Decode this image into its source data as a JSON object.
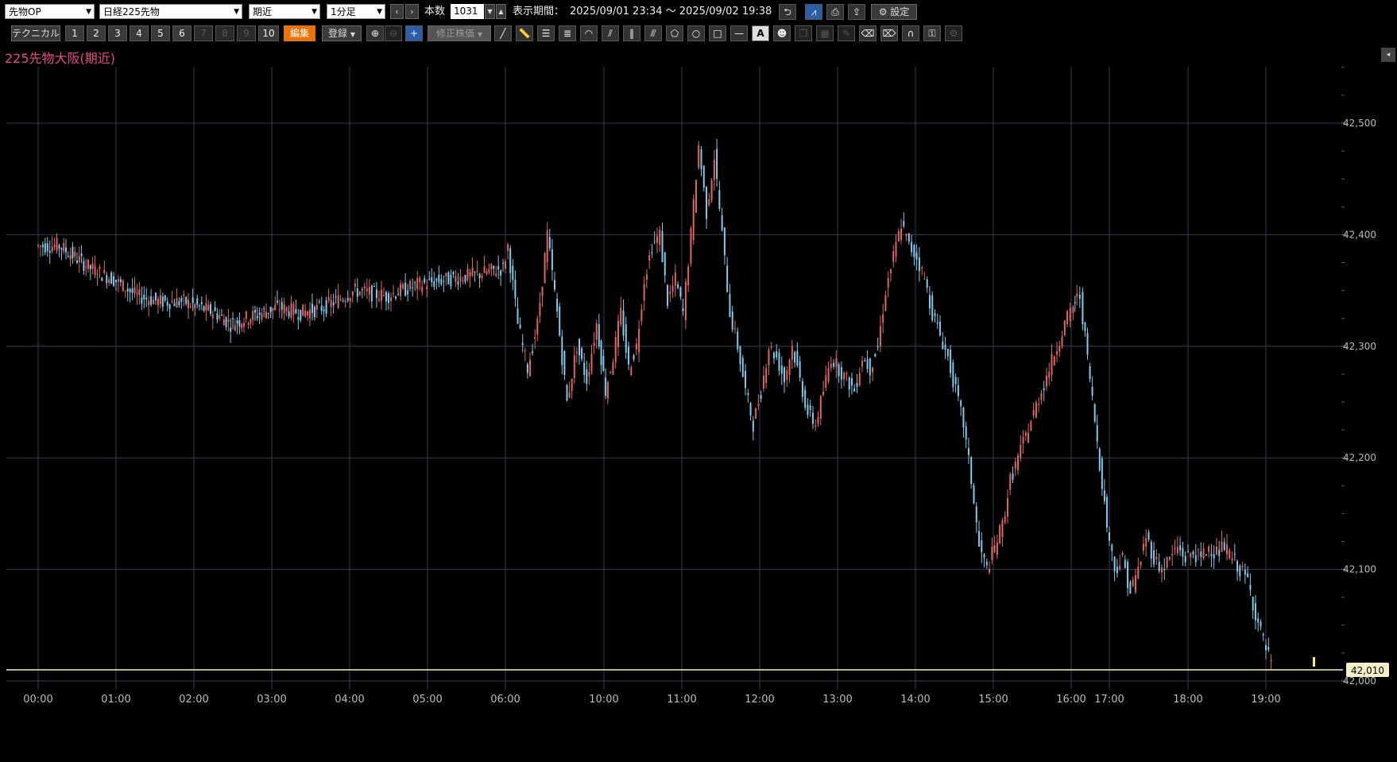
{
  "toolbar": {
    "market_select": "先物OP",
    "product_select": "日経225先物",
    "contract_select": "期近",
    "interval_select": "1分足",
    "count_label": "本数",
    "count_value": "1031",
    "period_label": "表示期間：",
    "period_value": "2025/09/01 23:34 ～ 2025/09/02 19:38",
    "settings_label": "設定",
    "technical_label": "テクニカル",
    "numbers": [
      "1",
      "2",
      "3",
      "4",
      "5",
      "6",
      "7",
      "8",
      "9",
      "10"
    ],
    "edit_label": "編集",
    "register_label": "登録",
    "adjusted_price_label": "修正株価"
  },
  "chart_title": "225先物大阪(期近)",
  "current_price_label": "42,010",
  "colors": {
    "up": "#e06666",
    "down": "#7ecbeb",
    "grid": "#3a3a55",
    "title": "#e8458c",
    "price_line": "#f5f0c8"
  },
  "chart_data": {
    "type": "candlestick",
    "x_ticks": [
      "00:00",
      "01:00",
      "02:00",
      "03:00",
      "04:00",
      "05:00",
      "06:00",
      "10:00",
      "11:00",
      "12:00",
      "13:00",
      "14:00",
      "15:00",
      "16:00",
      "17:00",
      "18:00",
      "19:00"
    ],
    "y_ticks": [
      "42,500",
      "42,400",
      "42,300",
      "42,200",
      "42,100",
      "42,000"
    ],
    "ylim": [
      41980,
      42550
    ],
    "current_price": 42010,
    "grid": true,
    "path": [
      [
        0,
        42390
      ],
      [
        0.3,
        42390
      ],
      [
        0.5,
        42380
      ],
      [
        0.7,
        42370
      ],
      [
        1.0,
        42360
      ],
      [
        1.3,
        42345
      ],
      [
        1.6,
        42340
      ],
      [
        1.9,
        42340
      ],
      [
        2.1,
        42335
      ],
      [
        2.3,
        42330
      ],
      [
        2.5,
        42320
      ],
      [
        2.7,
        42325
      ],
      [
        2.9,
        42330
      ],
      [
        3.1,
        42335
      ],
      [
        3.4,
        42330
      ],
      [
        3.7,
        42335
      ],
      [
        4.1,
        42350
      ],
      [
        4.5,
        42345
      ],
      [
        4.9,
        42355
      ],
      [
        5.3,
        42360
      ],
      [
        5.7,
        42365
      ],
      [
        6.0,
        42370
      ],
      [
        6.05,
        42390
      ],
      [
        6.15,
        42320
      ],
      [
        6.25,
        42280
      ],
      [
        6.35,
        42320
      ],
      [
        6.45,
        42400
      ],
      [
        6.55,
        42330
      ],
      [
        6.65,
        42250
      ],
      [
        6.75,
        42300
      ],
      [
        6.85,
        42270
      ],
      [
        6.95,
        42320
      ],
      [
        7.05,
        42260
      ],
      [
        7.15,
        42290
      ],
      [
        7.25,
        42330
      ],
      [
        7.35,
        42280
      ],
      [
        7.45,
        42300
      ],
      [
        7.55,
        42360
      ],
      [
        7.65,
        42390
      ],
      [
        7.75,
        42400
      ],
      [
        7.85,
        42340
      ],
      [
        7.95,
        42360
      ],
      [
        8.05,
        42330
      ],
      [
        8.15,
        42400
      ],
      [
        8.25,
        42480
      ],
      [
        8.35,
        42420
      ],
      [
        8.45,
        42470
      ],
      [
        8.55,
        42400
      ],
      [
        8.65,
        42330
      ],
      [
        8.75,
        42300
      ],
      [
        8.85,
        42260
      ],
      [
        8.95,
        42230
      ],
      [
        9.05,
        42260
      ],
      [
        9.15,
        42300
      ],
      [
        9.25,
        42290
      ],
      [
        9.35,
        42270
      ],
      [
        9.45,
        42300
      ],
      [
        9.55,
        42270
      ],
      [
        9.65,
        42240
      ],
      [
        9.75,
        42230
      ],
      [
        9.85,
        42260
      ],
      [
        9.95,
        42290
      ],
      [
        10.05,
        42280
      ],
      [
        10.15,
        42270
      ],
      [
        10.25,
        42260
      ],
      [
        10.35,
        42290
      ],
      [
        10.45,
        42280
      ],
      [
        10.55,
        42300
      ],
      [
        10.65,
        42350
      ],
      [
        10.75,
        42380
      ],
      [
        10.85,
        42410
      ],
      [
        10.95,
        42390
      ],
      [
        11.05,
        42380
      ],
      [
        11.15,
        42360
      ],
      [
        11.25,
        42330
      ],
      [
        11.35,
        42310
      ],
      [
        11.45,
        42290
      ],
      [
        11.55,
        42260
      ],
      [
        11.65,
        42230
      ],
      [
        11.75,
        42180
      ],
      [
        11.85,
        42120
      ],
      [
        11.95,
        42100
      ],
      [
        12.05,
        42120
      ],
      [
        12.15,
        42140
      ],
      [
        12.25,
        42180
      ],
      [
        12.35,
        42200
      ],
      [
        12.45,
        42220
      ],
      [
        12.55,
        42240
      ],
      [
        12.65,
        42260
      ],
      [
        12.75,
        42280
      ],
      [
        12.85,
        42300
      ],
      [
        12.95,
        42320
      ],
      [
        13.05,
        42330
      ],
      [
        13.15,
        42340
      ],
      [
        13.3,
        42345
      ],
      [
        14.0,
        42140
      ],
      [
        14.1,
        42100
      ],
      [
        14.2,
        42110
      ],
      [
        14.3,
        42080
      ],
      [
        14.4,
        42100
      ],
      [
        14.5,
        42130
      ],
      [
        14.6,
        42110
      ],
      [
        14.7,
        42100
      ],
      [
        14.8,
        42110
      ],
      [
        14.9,
        42120
      ],
      [
        15.0,
        42110
      ],
      [
        15.1,
        42115
      ],
      [
        15.2,
        42110
      ],
      [
        15.3,
        42120
      ],
      [
        15.4,
        42115
      ],
      [
        15.5,
        42120
      ],
      [
        15.6,
        42110
      ],
      [
        15.7,
        42100
      ],
      [
        15.8,
        42090
      ],
      [
        15.9,
        42060
      ],
      [
        16.0,
        42035
      ],
      [
        16.1,
        42015
      ]
    ]
  }
}
